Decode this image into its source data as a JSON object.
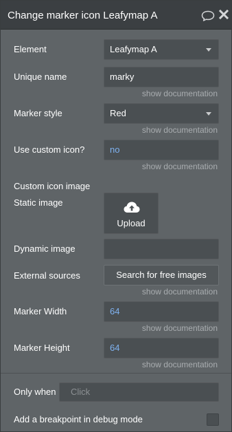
{
  "header": {
    "title": "Change marker icon Leafymap A",
    "comment_icon": "comment-icon",
    "close_icon": "close-icon"
  },
  "doc_link": "show documentation",
  "fields": {
    "element": {
      "label": "Element",
      "value": "Leafymap A"
    },
    "unique_name": {
      "label": "Unique name",
      "value": "marky"
    },
    "marker_style": {
      "label": "Marker style",
      "value": "Red"
    },
    "use_custom_icon": {
      "label": "Use custom icon?",
      "value": "no"
    },
    "custom_icon_image": {
      "label": "Custom icon image"
    },
    "static_image": {
      "label": "Static image",
      "button": "Upload",
      "icon": "upload-cloud-icon"
    },
    "dynamic_image": {
      "label": "Dynamic image",
      "value": ""
    },
    "external_sources": {
      "label": "External sources",
      "button": "Search for free images"
    },
    "marker_width": {
      "label": "Marker Width",
      "value": "64"
    },
    "marker_height": {
      "label": "Marker Height",
      "value": "64"
    }
  },
  "footer": {
    "only_when_label": "Only when",
    "only_when_placeholder": "Click",
    "breakpoint_label": "Add a breakpoint in debug mode",
    "breakpoint_checked": false
  },
  "colors": {
    "panel_bg": "#5f6467",
    "titlebar_bg": "#3b3f42",
    "field_bg": "#4a4f52",
    "link_value": "#7fb2f0",
    "doc_text": "#a9adb0"
  }
}
